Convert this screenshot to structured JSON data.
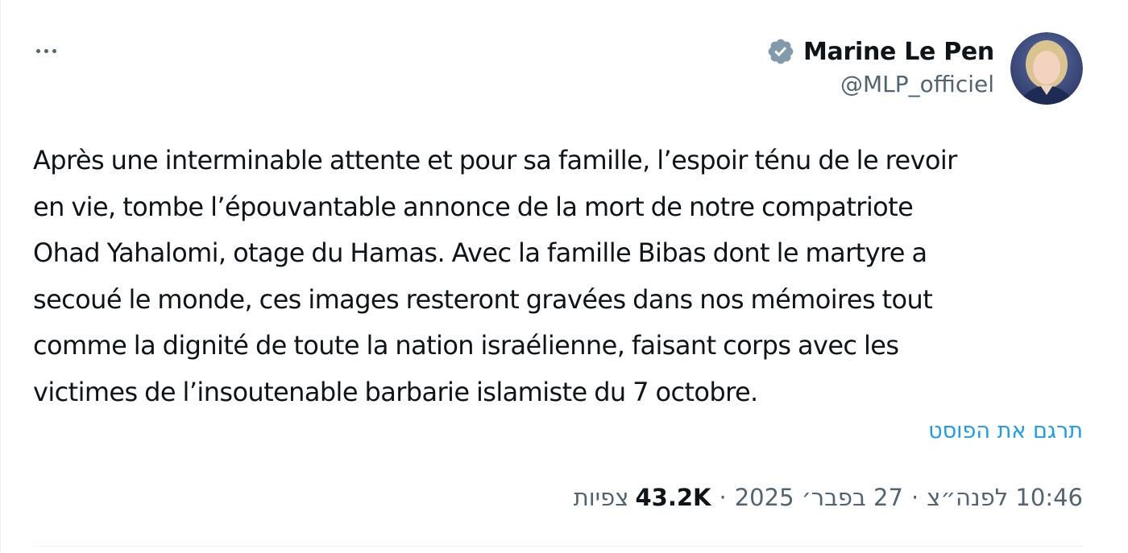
{
  "post": {
    "author": {
      "name": "Marine Le Pen",
      "handle": "@MLP_officiel",
      "verified_color": "#829aab"
    },
    "text_lines": [
      "Après une interminable attente et pour sa famille, l’espoir ténu de le revoir",
      "en vie, tombe l’épouvantable annonce de la mort de notre compatriote",
      "Ohad Yahalomi, otage du Hamas. Avec la famille Bibas dont le martyre a",
      "secoué le monde, ces images resteront gravées dans nos mémoires tout",
      "comme la dignité de toute la nation israélienne, faisant corps avec les",
      "victimes de l’insoutenable barbarie islamiste du 7 octobre."
    ],
    "translate_label": "תרגם את הפוסט",
    "meta": {
      "time": "10:46 לפנה״צ",
      "date": "27 בפבר׳ 2025",
      "views_count": "43.2K",
      "views_label": "צפיות"
    }
  },
  "colors": {
    "accent": "#1d9bf0",
    "text": "#0f1419",
    "muted": "#536471"
  },
  "icons": {
    "more": "more-horizontal-icon",
    "verified": "verified-badge-icon"
  }
}
